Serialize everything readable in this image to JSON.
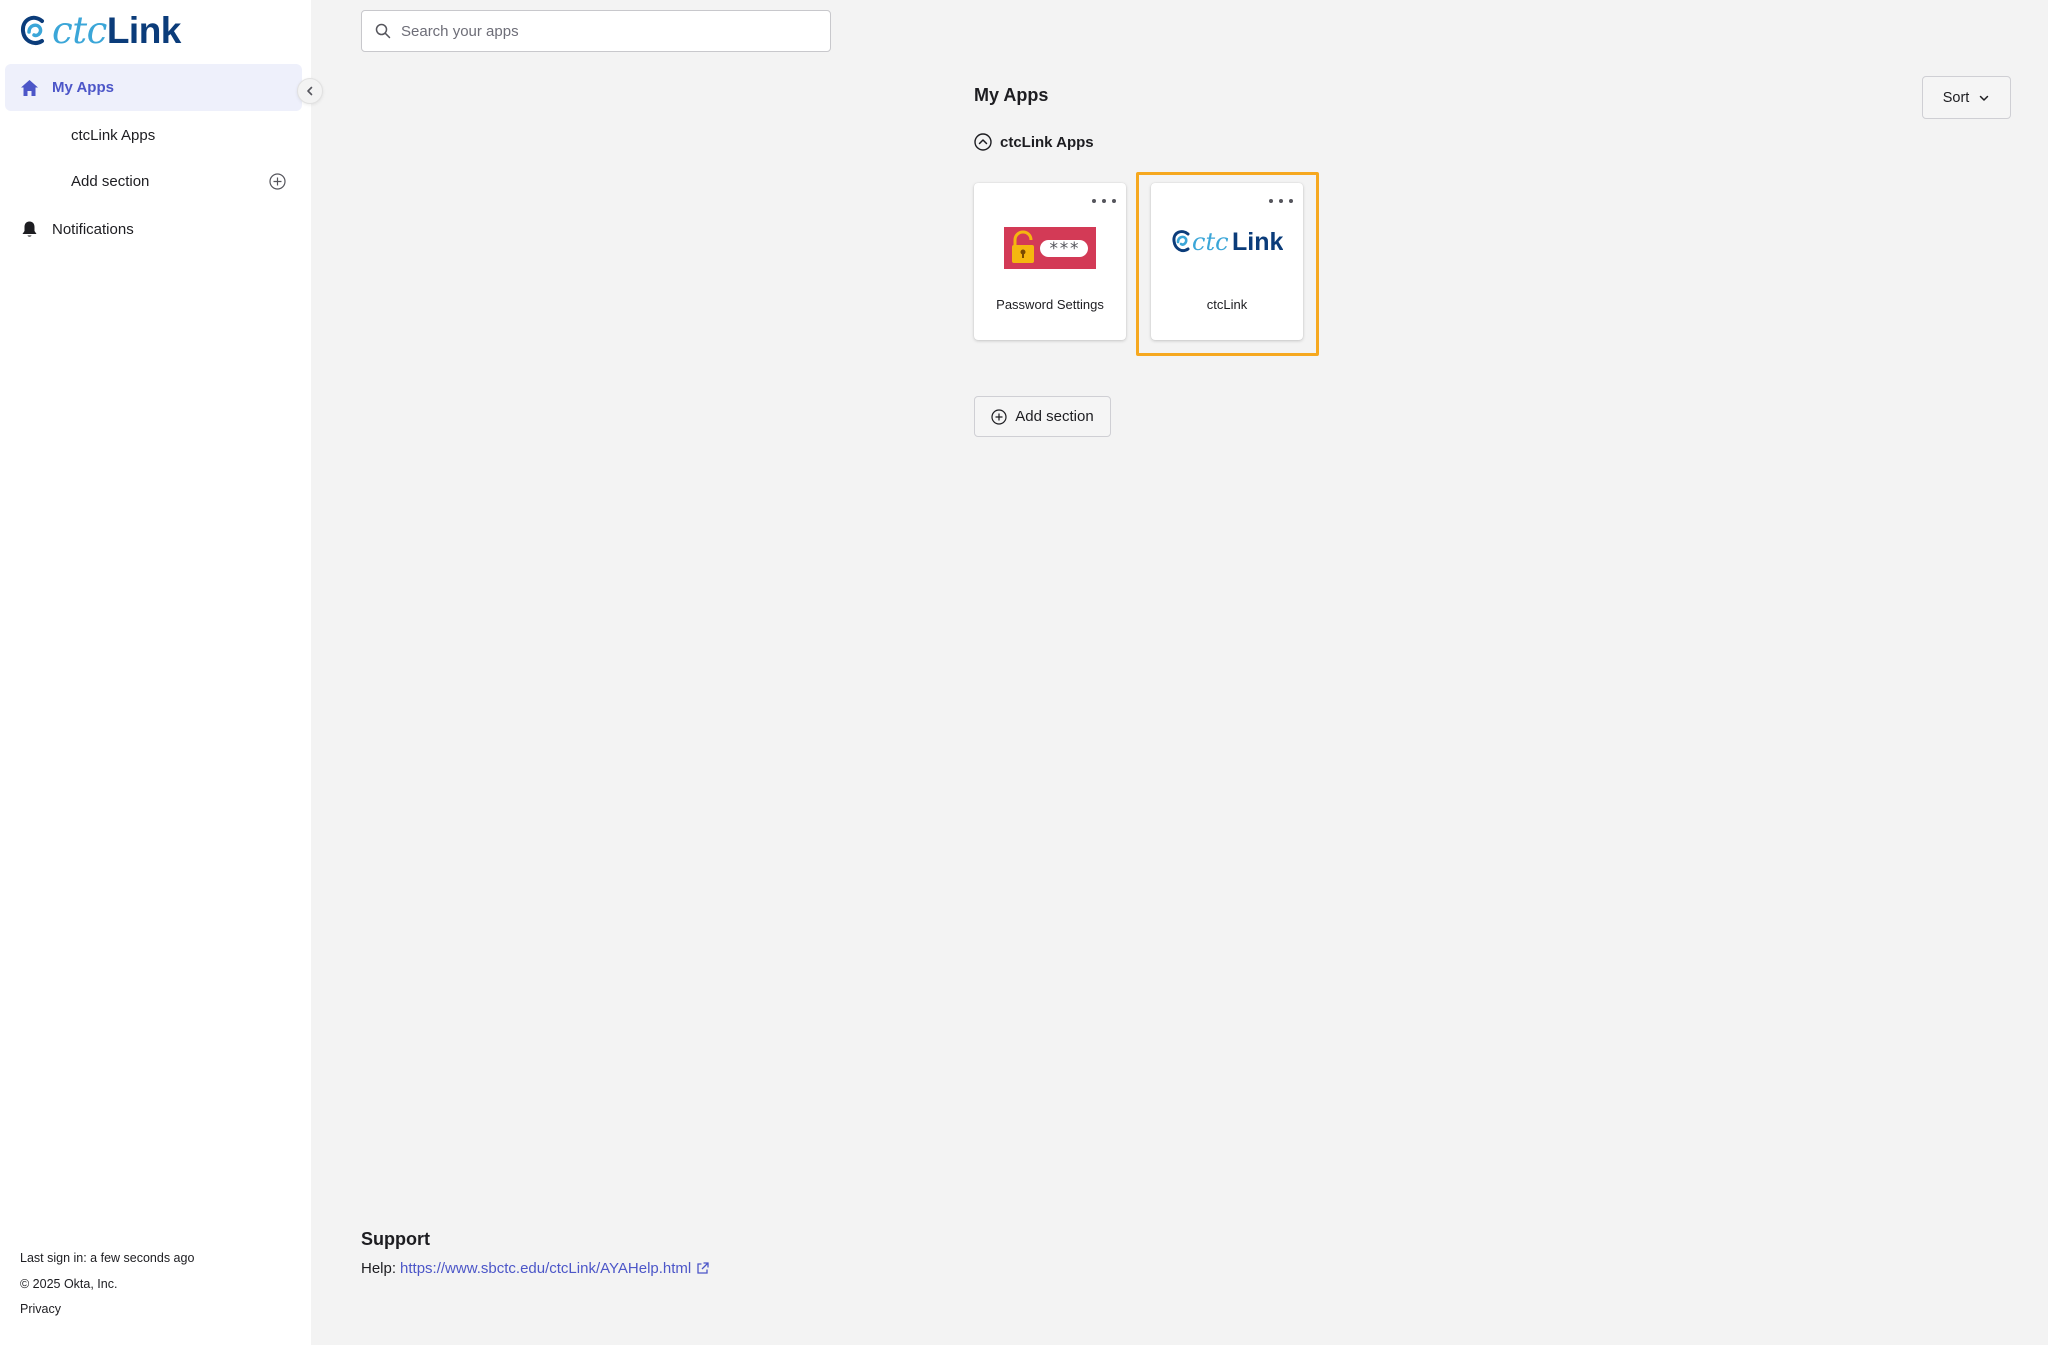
{
  "logo": {
    "part1": "ctc",
    "part2": "Link"
  },
  "sidebar": {
    "items": [
      {
        "label": "My Apps",
        "icon": "home-icon",
        "active": true
      },
      {
        "label": "ctcLink Apps"
      },
      {
        "label": "Add section",
        "icon": "plus-circle-icon"
      },
      {
        "label": "Notifications",
        "icon": "bell-icon"
      }
    ],
    "footer": {
      "last_sign_in": "Last sign in: a few seconds ago",
      "copyright": "© 2025 Okta, Inc.",
      "privacy": "Privacy"
    }
  },
  "search": {
    "placeholder": "Search your apps",
    "value": ""
  },
  "main": {
    "title": "My Apps",
    "sort_label": "Sort",
    "section": {
      "title": "ctcLink Apps",
      "apps": [
        {
          "label": "Password Settings",
          "icon": "password-lock-icon"
        },
        {
          "label": "ctcLink",
          "icon": "ctclink-logo"
        }
      ]
    },
    "add_section_label": "Add section"
  },
  "support": {
    "title": "Support",
    "help_prefix": "Help:",
    "help_url": "https://www.sbctc.edu/ctcLink/AYAHelp.html"
  },
  "colors": {
    "accent": "#4c56c8",
    "highlight": "#f6a81f",
    "active_bg": "#eef0fb",
    "password_tile_bg": "#d33a56"
  }
}
